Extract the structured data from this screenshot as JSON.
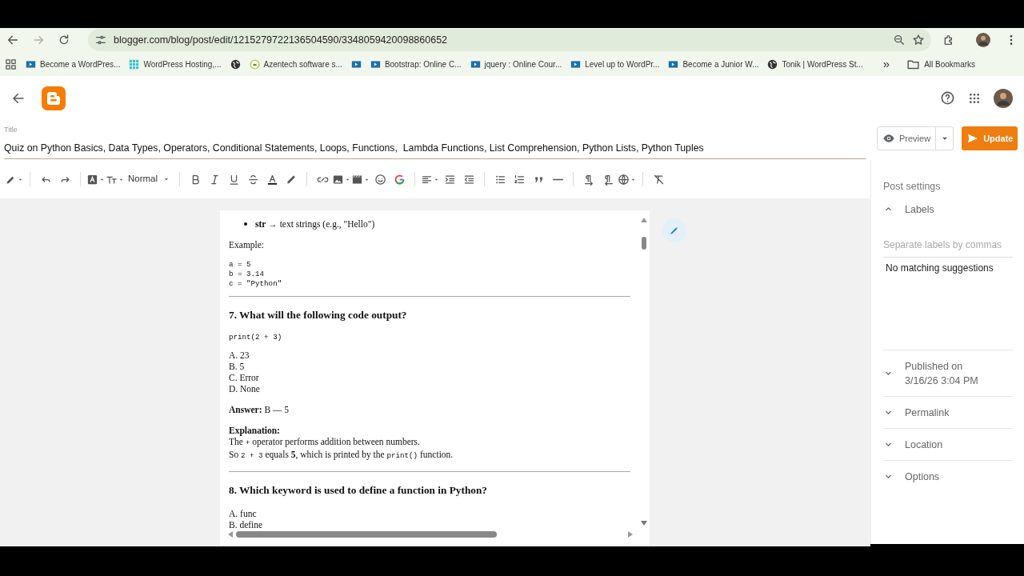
{
  "browser": {
    "url": "blogger.com/blog/post/edit/1215279722136504590/3348059420098860652",
    "bookmarks": [
      {
        "kind": "video",
        "label": "Become a WordPres..."
      },
      {
        "kind": "grid",
        "label": "WordPress Hosting,..."
      },
      {
        "kind": "globe"
      },
      {
        "kind": "android",
        "label": "Azentech software s..."
      },
      {
        "kind": "video"
      },
      {
        "kind": "video",
        "label": "Bootstrap: Online C..."
      },
      {
        "kind": "video",
        "label": "jquery : Online Cour..."
      },
      {
        "kind": "video",
        "label": "Level up to WordPr..."
      },
      {
        "kind": "video",
        "label": "Become a Junior W..."
      },
      {
        "kind": "globe",
        "label": "Tonik | WordPress St..."
      }
    ],
    "overflow": "»",
    "all_bookmarks": "All Bookmarks"
  },
  "post": {
    "title_label": "Title",
    "title": "Quiz on Python Basics, Data Types, Operators, Conditional Statements, Loops, Functions,  Lambda Functions, List Comprehension, Python Lists, Python Tuples",
    "preview": "Preview",
    "update": "Update"
  },
  "toolbar": {
    "paragraph_style": "Normal"
  },
  "document": [
    {
      "kind": "bullet",
      "runs": [
        {
          "text": "**str** → text strings (e.g., \"Hello\")"
        }
      ]
    },
    {
      "kind": "para",
      "lines": [
        [
          {
            "text": "Example:"
          }
        ]
      ]
    },
    {
      "kind": "code",
      "lines": [
        "a = 5",
        "b = 3.14",
        "c = \"Python\""
      ]
    },
    {
      "kind": "rule"
    },
    {
      "kind": "heading",
      "text": "7. What will the following code output?"
    },
    {
      "kind": "code",
      "lines": [
        "print(2 + 3)"
      ]
    },
    {
      "kind": "para",
      "lines": [
        [
          {
            "text": "A. 23"
          }
        ],
        [
          {
            "text": "B. 5"
          }
        ],
        [
          {
            "text": "C. Error"
          }
        ],
        [
          {
            "text": "D. None"
          }
        ]
      ]
    },
    {
      "kind": "para",
      "lines": [
        [
          {
            "text": "**Answer:** B — 5"
          }
        ]
      ]
    },
    {
      "kind": "para",
      "lines": [
        [
          {
            "text": "**Explanation:**"
          }
        ],
        [
          {
            "text": "The "
          },
          {
            "text": "+",
            "kind": "code"
          },
          {
            "text": " operator performs addition between numbers."
          }
        ],
        [
          {
            "text": "So "
          },
          {
            "text": "2 + 3",
            "kind": "code"
          },
          {
            "text": " equals **5**, which is printed by the "
          },
          {
            "text": "print()",
            "kind": "code"
          },
          {
            "text": " function."
          }
        ]
      ]
    },
    {
      "kind": "rule"
    },
    {
      "kind": "heading",
      "text": "8. Which keyword is used to define a function in Python?"
    },
    {
      "kind": "para",
      "lines": [
        [
          {
            "text": "A. func"
          }
        ],
        [
          {
            "text": "B. define"
          }
        ]
      ]
    }
  ],
  "settings": {
    "heading": "Post settings",
    "labels": {
      "title": "Labels",
      "expanded": true,
      "placeholder": "Separate labels by commas",
      "suggestion": "No matching suggestions"
    },
    "sections": [
      {
        "title": "Published on",
        "detail": "3/16/26 3:04 PM",
        "expanded": false
      },
      {
        "title": "Permalink",
        "expanded": false
      },
      {
        "title": "Location",
        "expanded": false
      },
      {
        "title": "Options",
        "expanded": false
      }
    ]
  }
}
